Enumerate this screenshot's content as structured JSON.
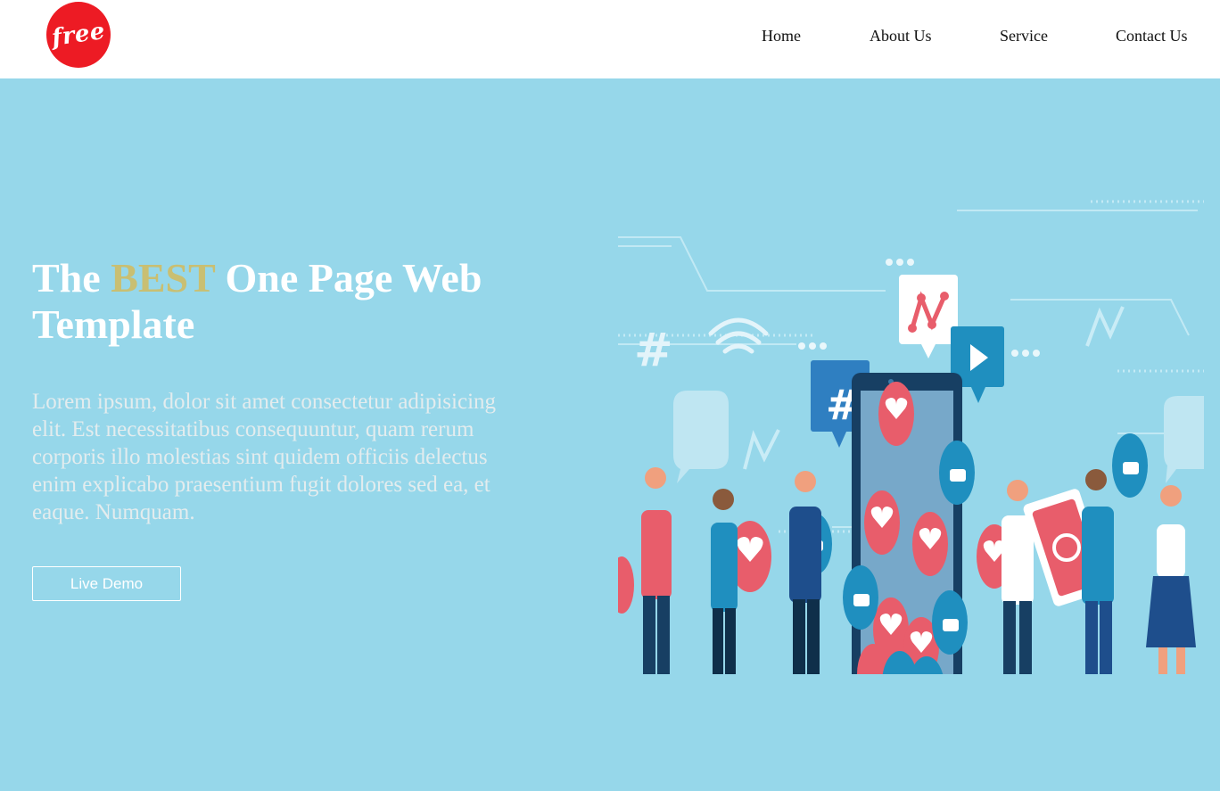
{
  "brand": {
    "logo_text": "free",
    "logo_color": "#ed1b24"
  },
  "nav": {
    "items": [
      "Home",
      "About Us",
      "Service",
      "Contact Us"
    ]
  },
  "hero": {
    "title_before": "The ",
    "title_highlight": "BEST",
    "title_after": " One Page Web Template",
    "description": "Lorem ipsum, dolor sit amet consectetur adipisicing elit. Est necessitatibus consequuntur, quam rerum corporis illo molestias sint quidem officiis delectus enim explicabo praesentium fugit dolores sed ea, et eaque. Numquam.",
    "cta_label": "Live Demo",
    "background_color": "#96d7ea",
    "highlight_color": "#c9bf72"
  },
  "illustration": {
    "hash_symbol": "#",
    "icons": [
      "hashtag-bubble-icon",
      "play-bubble-icon",
      "chart-bubble-icon",
      "heart-icon",
      "thumbs-up-icon",
      "camera-icon",
      "wifi-icon",
      "smartphone-icon"
    ]
  }
}
